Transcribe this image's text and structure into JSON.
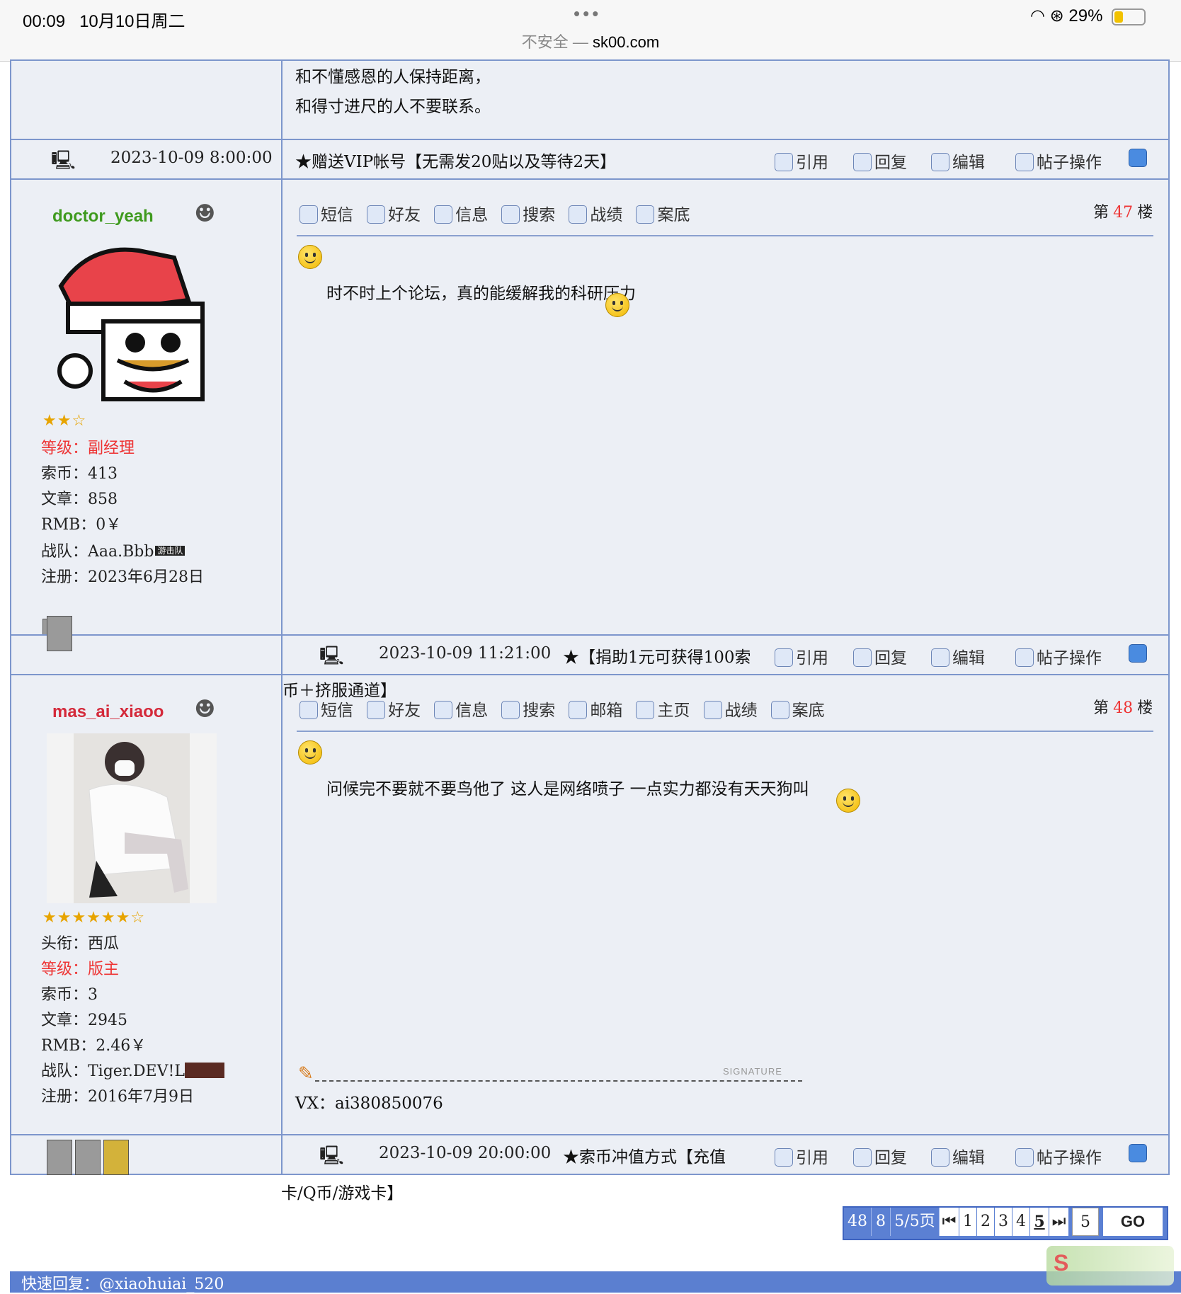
{
  "status_bar": {
    "time": "00:09",
    "date": "10月10日周二",
    "dots": "•••",
    "insecure": "不安全 —",
    "domain": "sk00.com",
    "battery": "29%"
  },
  "actions": {
    "quote": "引用",
    "reply": "回复",
    "edit": "编辑",
    "post_ops": "帖子操作"
  },
  "toolbar": {
    "message": "短信",
    "friend": "好友",
    "info": "信息",
    "search": "搜索",
    "mailbox": "邮箱",
    "homepage": "主页",
    "record": "战绩",
    "case": "案底"
  },
  "floor_prefix": "第",
  "floor_suffix": "楼",
  "prev_post": {
    "lines": [
      "和不懂感恩的人保持距离，",
      "和得寸进尺的人不要联系。"
    ],
    "date": "2023-10-09 8:00:00",
    "title": "★赠送VIP帐号【无需发20贴以及等待2天】"
  },
  "post47": {
    "floor": "47",
    "username": "doctor_yeah",
    "stars": "★★☆",
    "level_label": "等级：",
    "level": "副经理",
    "coins": "索币：413",
    "articles": "文章：858",
    "rmb": "RMB：0￥",
    "team": "战队：Aaa.Bbb",
    "team_badge": "游击队",
    "register": "注册：2023年6月28日",
    "content": "时不时上个论坛，真的能缓解我的科研压力",
    "date": "2023-10-09 11:21:00",
    "title_line1": "★【捐助1元可获得100索",
    "title_line2": "币＋挤服通道】"
  },
  "post48": {
    "floor": "48",
    "username": "mas_ai_xiaoo",
    "stars": "★★★★★★☆",
    "title_field": "头衔：西瓜",
    "level_label": "等级：",
    "level": "版主",
    "coins": "索币：3",
    "articles": "文章：2945",
    "rmb": "RMB：2.46￥",
    "team": "战队：Tiger.DEV!L",
    "register": "注册：2016年7月9日",
    "content": "问候完不要就不要鸟他了  这人是网络喷子 一点实力都没有天天狗叫",
    "signature_label": "SIGNATURE",
    "signature": "VX：ai380850076",
    "date": "2023-10-09 20:00:00",
    "title_line1": "★索币冲值方式【充值",
    "title_line2": "卡/Q币/游戏卡】"
  },
  "pagination": {
    "total": "48",
    "per_page": "8",
    "pages": "5/5页",
    "first": "⏮",
    "page_links": [
      "1",
      "2",
      "3",
      "4",
      "5"
    ],
    "current": "5",
    "last": "⏭",
    "input_value": "5",
    "go": "GO"
  },
  "quick_reply": "快速回复：@xiaohuiai_520",
  "colors": {
    "cell_bg": "#eceff5",
    "border": "#7d96cc",
    "username47": "#3f9a1e",
    "username48": "#d4293a",
    "accent_red": "#e33333",
    "pager_blue": "#5b80d3"
  }
}
